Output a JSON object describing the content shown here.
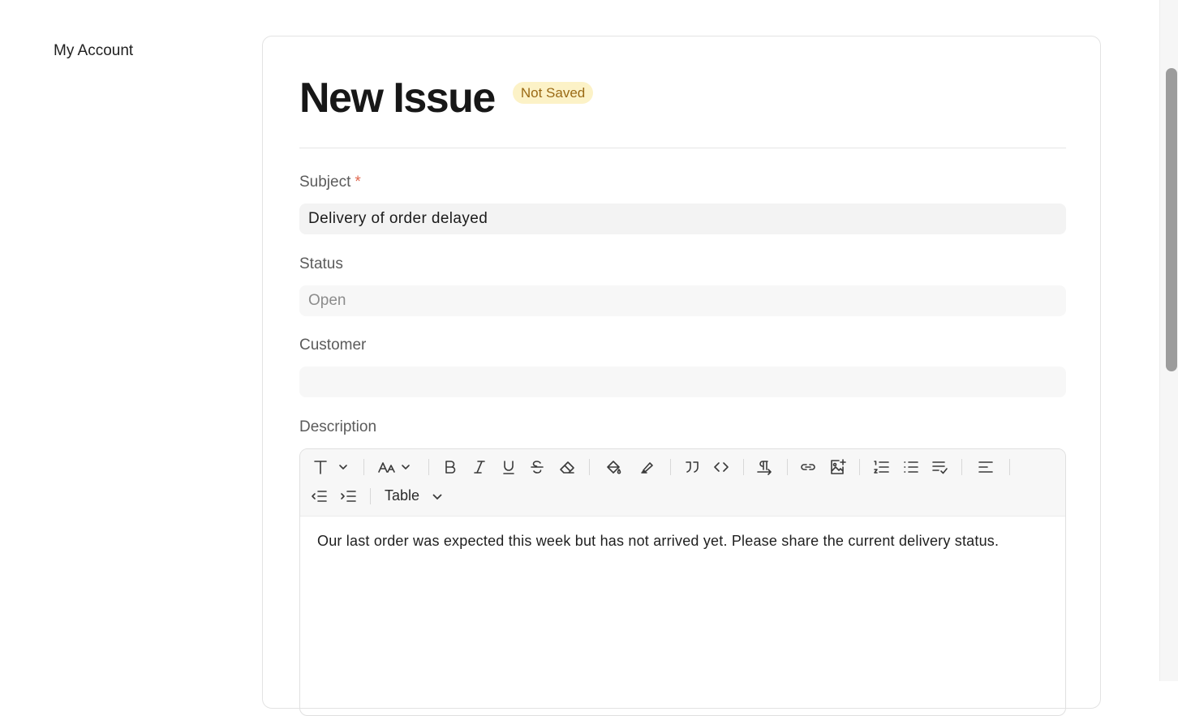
{
  "sidebar": {
    "title": "My Account"
  },
  "form": {
    "title": "New Issue",
    "badge": "Not Saved",
    "subject": {
      "label": "Subject",
      "required_mark": "*",
      "value": "Delivery of order delayed"
    },
    "status": {
      "label": "Status",
      "value": "Open"
    },
    "customer": {
      "label": "Customer",
      "value": ""
    },
    "description": {
      "label": "Description",
      "table_label": "Table",
      "content": "Our last order was expected this week but has not arrived yet. Please share the current delivery status."
    }
  },
  "toolbar_icons": [
    "text-style-icon",
    "font-size-icon",
    "bold-icon",
    "italic-icon",
    "underline-icon",
    "strikethrough-icon",
    "eraser-icon",
    "paint-bucket-icon",
    "highlighter-icon",
    "quote-icon",
    "code-icon",
    "paragraph-direction-icon",
    "link-icon",
    "image-add-icon",
    "ordered-list-icon",
    "bullet-list-icon",
    "task-list-icon",
    "align-left-icon",
    "outdent-icon",
    "indent-icon"
  ],
  "colors": {
    "badge_bg": "#fcf2c7",
    "badge_text": "#9a6a15",
    "required": "#e0684f"
  }
}
